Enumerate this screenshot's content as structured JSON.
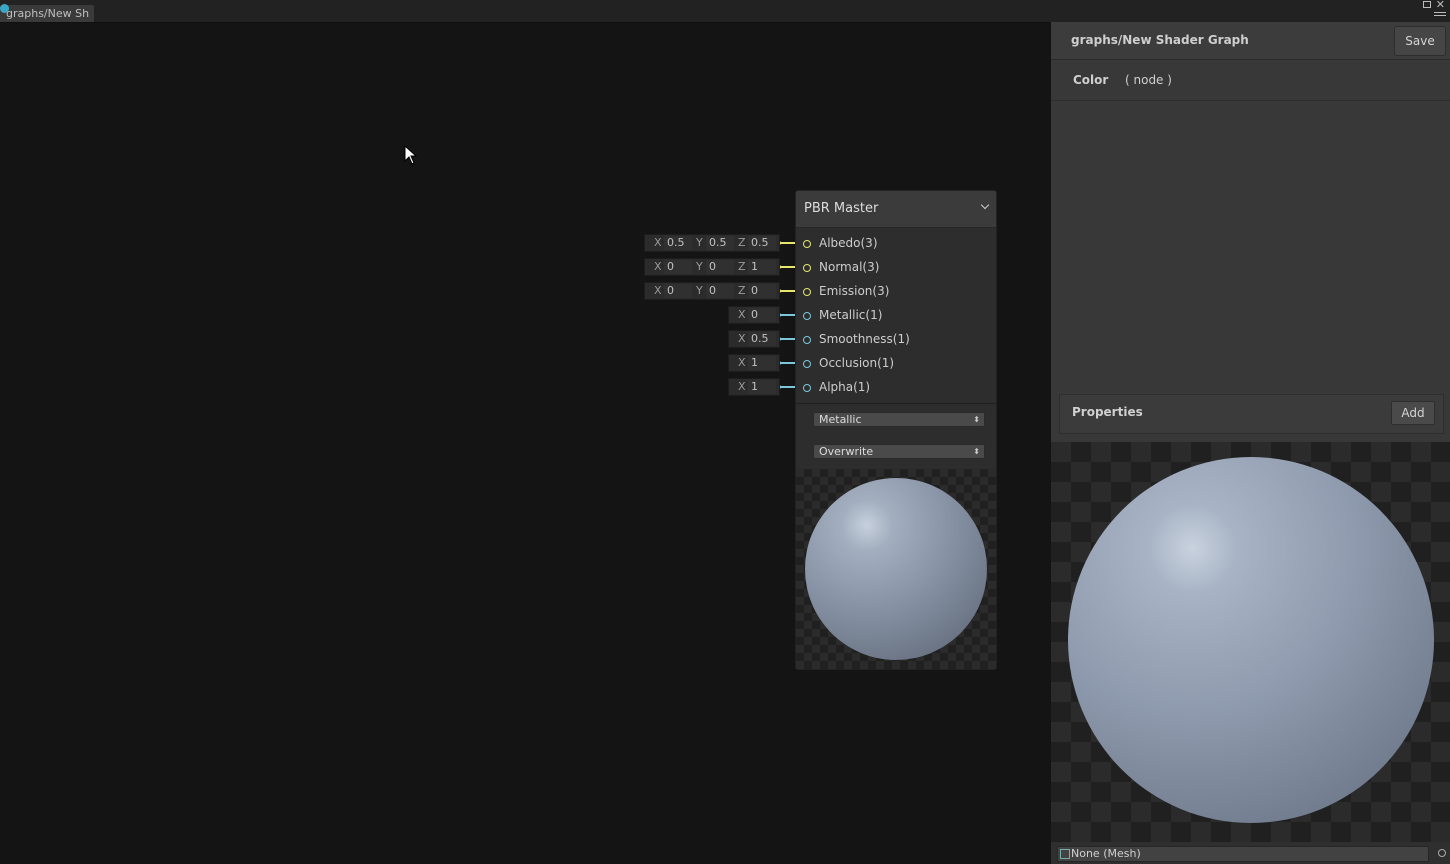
{
  "window": {
    "tab_title": "graphs/New Sh"
  },
  "node": {
    "title": "PBR Master",
    "ports": [
      {
        "label": "Albedo(3)",
        "kind": "vector3",
        "color": "#e6e66a",
        "values": [
          [
            "X",
            "0.5"
          ],
          [
            "Y",
            "0.5"
          ],
          [
            "Z",
            "0.5"
          ]
        ]
      },
      {
        "label": "Normal(3)",
        "kind": "vector3",
        "color": "#e6e66a",
        "values": [
          [
            "X",
            "0"
          ],
          [
            "Y",
            "0"
          ],
          [
            "Z",
            "1"
          ]
        ]
      },
      {
        "label": "Emission(3)",
        "kind": "vector3",
        "color": "#e6e66a",
        "values": [
          [
            "X",
            "0"
          ],
          [
            "Y",
            "0"
          ],
          [
            "Z",
            "0"
          ]
        ]
      },
      {
        "label": "Metallic(1)",
        "kind": "vector1",
        "color": "#7ac9da",
        "values": [
          [
            "X",
            "0"
          ]
        ]
      },
      {
        "label": "Smoothness(1)",
        "kind": "vector1",
        "color": "#7ac9da",
        "values": [
          [
            "X",
            "0.5"
          ]
        ]
      },
      {
        "label": "Occlusion(1)",
        "kind": "vector1",
        "color": "#7ac9da",
        "values": [
          [
            "X",
            "1"
          ]
        ]
      },
      {
        "label": "Alpha(1)",
        "kind": "vector1",
        "color": "#7ac9da",
        "values": [
          [
            "X",
            "1"
          ]
        ]
      }
    ],
    "workflow_dropdown": "Metallic",
    "surface_dropdown": "Overwrite"
  },
  "inspector": {
    "title": "graphs/New Shader Graph",
    "save_label": "Save",
    "color_label": "Color",
    "color_node": "(   node   )",
    "properties_label": "Properties",
    "add_label": "Add",
    "mesh_value": "None (Mesh)"
  },
  "colors": {
    "vector3_port": "#e6e66a",
    "vector1_port": "#7ac9da"
  }
}
